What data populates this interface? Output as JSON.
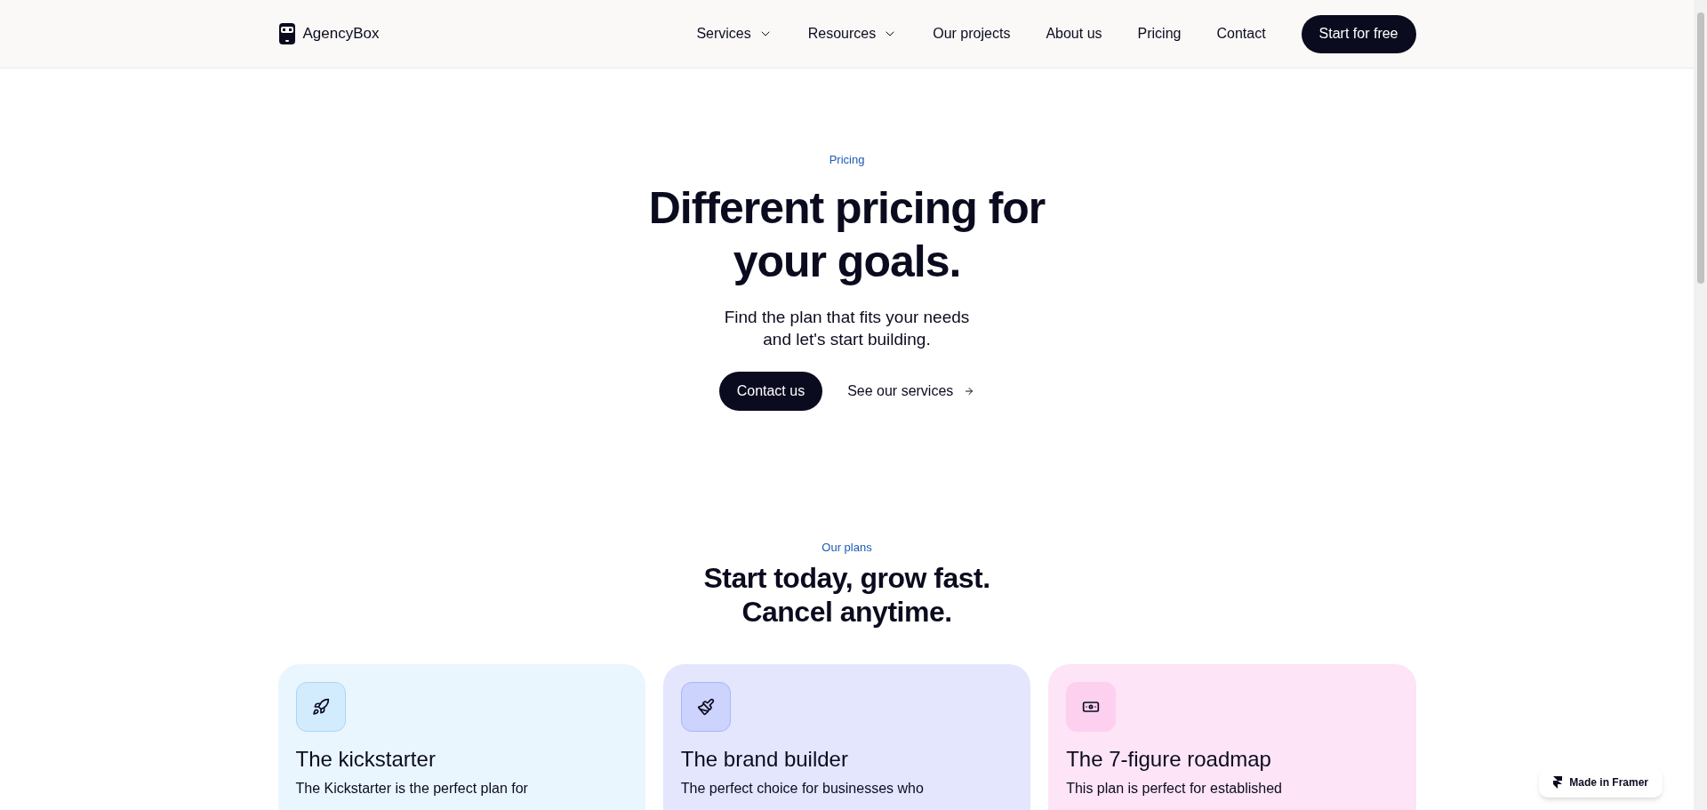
{
  "nav": {
    "brand": "AgencyBox",
    "items": [
      {
        "label": "Services",
        "dropdown": true
      },
      {
        "label": "Resources",
        "dropdown": true
      },
      {
        "label": "Our projects",
        "dropdown": false
      },
      {
        "label": "About us",
        "dropdown": false
      },
      {
        "label": "Pricing",
        "dropdown": false
      },
      {
        "label": "Contact",
        "dropdown": false
      }
    ],
    "cta": "Start for free"
  },
  "hero": {
    "eyebrow": "Pricing",
    "title_lines": [
      "Different pricing for",
      "your goals."
    ],
    "subtitle_lines": [
      "Find the plan that fits your needs",
      "and let's start building."
    ],
    "primary": "Contact us",
    "secondary": "See our services"
  },
  "plans_section": {
    "eyebrow": "Our plans",
    "title_lines": [
      "Start today, grow fast.",
      "Cancel anytime."
    ]
  },
  "plans": [
    {
      "kind": "rocket",
      "color": "#e9f6fe",
      "title": "The kickstarter",
      "description": "The Kickstarter is the perfect plan for"
    },
    {
      "kind": "brush",
      "color": "#e3e6fd",
      "title": "The brand builder",
      "description": "The perfect choice for businesses who"
    },
    {
      "kind": "money",
      "color": "#fde4f6",
      "title": "The 7-figure roadmap",
      "description": "This plan is perfect for established"
    }
  ],
  "badge": "Made in Framer"
}
